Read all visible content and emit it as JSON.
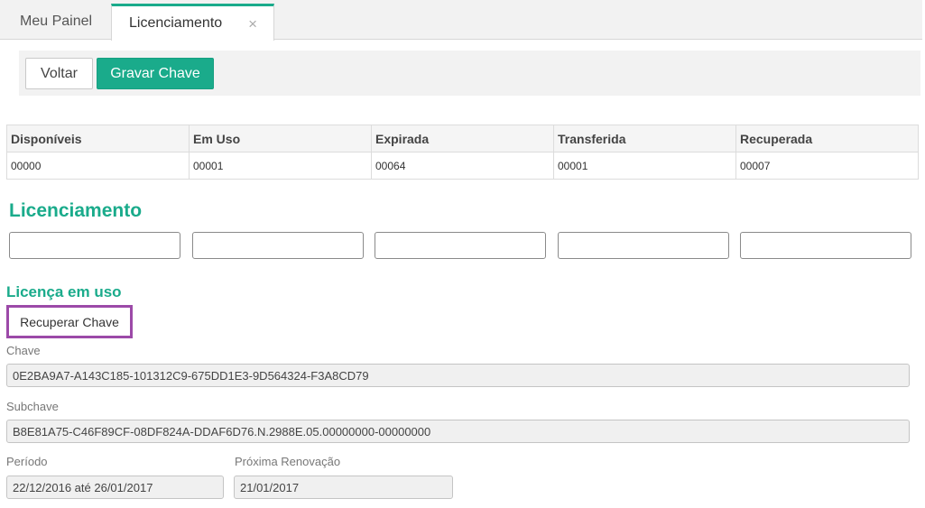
{
  "tabs": {
    "home_label": "Meu Painel",
    "active_label": "Licenciamento",
    "close_glyph": "×"
  },
  "toolbar": {
    "voltar_label": "Voltar",
    "gravar_label": "Gravar Chave"
  },
  "stats": {
    "headers": [
      "Disponíveis",
      "Em Uso",
      "Expirada",
      "Transferida",
      "Recuperada"
    ],
    "values": [
      "00000",
      "00001",
      "00064",
      "00001",
      "00007"
    ]
  },
  "licenciamento": {
    "title": "Licenciamento"
  },
  "licenca_em_uso": {
    "title": "Licença em uso",
    "recuperar_label": "Recuperar Chave",
    "chave_label": "Chave",
    "chave_value": "0E2BA9A7-A143C185-101312C9-675DD1E3-9D564324-F3A8CD79",
    "subchave_label": "Subchave",
    "subchave_value": "B8E81A75-C46F89CF-08DF824A-DDAF6D76.N.2988E.05.00000000-00000000",
    "periodo_label": "Período",
    "periodo_value": "22/12/2016 até 26/01/2017",
    "renovacao_label": "Próxima Renovação",
    "renovacao_value": "21/01/2017"
  },
  "colors": {
    "accent": "#1aab8b",
    "highlight_border": "#9c4aa8"
  }
}
